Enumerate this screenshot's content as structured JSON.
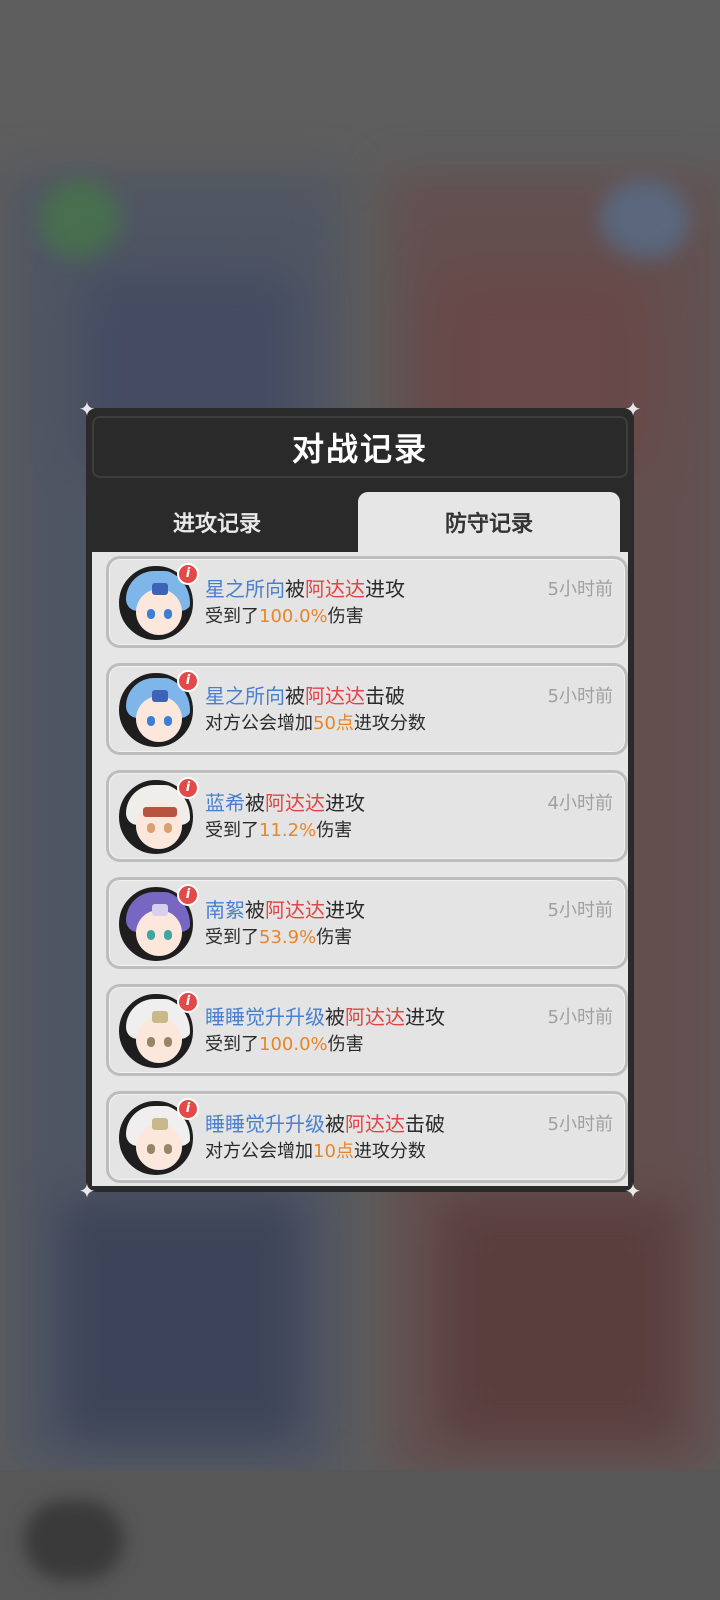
{
  "modal": {
    "title": "对战记录",
    "tabs": [
      {
        "label": "进攻记录",
        "active": false
      },
      {
        "label": "防守记录",
        "active": true
      }
    ]
  },
  "records": [
    {
      "defender": "星之所向",
      "by": "被",
      "attacker": "阿达达",
      "action": "进攻",
      "time": "5小时前",
      "detail_pre": "受到了",
      "detail_value": "100.0%",
      "detail_post": "伤害",
      "avatar": "blue-hair-girl"
    },
    {
      "defender": "星之所向",
      "by": "被",
      "attacker": "阿达达",
      "action": "击破",
      "time": "5小时前",
      "detail_pre": "对方公会增加",
      "detail_value": "50点",
      "detail_post": "进攻分数",
      "avatar": "blue-hair-girl"
    },
    {
      "defender": "蓝希",
      "by": "被",
      "attacker": "阿达达",
      "action": "进攻",
      "time": "4小时前",
      "detail_pre": "受到了",
      "detail_value": "11.2%",
      "detail_post": "伤害",
      "avatar": "white-hair-bandaged"
    },
    {
      "defender": "南絮",
      "by": "被",
      "attacker": "阿达达",
      "action": "进攻",
      "time": "5小时前",
      "detail_pre": "受到了",
      "detail_value": "53.9%",
      "detail_post": "伤害",
      "avatar": "purple-hair-girl"
    },
    {
      "defender": "睡睡觉升升级",
      "by": "被",
      "attacker": "阿达达",
      "action": "进攻",
      "time": "5小时前",
      "detail_pre": "受到了",
      "detail_value": "100.0%",
      "detail_post": "伤害",
      "avatar": "white-hair-boy"
    },
    {
      "defender": "睡睡觉升升级",
      "by": "被",
      "attacker": "阿达达",
      "action": "击破",
      "time": "5小时前",
      "detail_pre": "对方公会增加",
      "detail_value": "10点",
      "detail_post": "进攻分数",
      "avatar": "white-hair-boy"
    }
  ],
  "icons": {
    "info_badge": "info-icon",
    "corner": "corner-ornament-icon"
  },
  "colors": {
    "defender_name": "#4a7fd0",
    "attacker_name": "#e14545",
    "value": "#e8852a",
    "time": "#a0a0a0"
  }
}
